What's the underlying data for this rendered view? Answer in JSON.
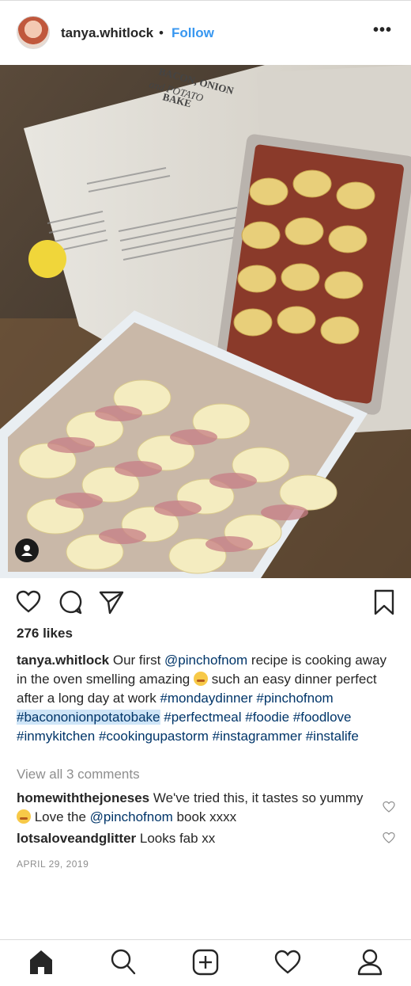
{
  "post": {
    "username": "tanya.whitlock",
    "separator": "•",
    "follow_label": "Follow",
    "more_label": "•••",
    "likes": "276 likes",
    "caption": {
      "username": "tanya.whitlock",
      "t1": " Our first ",
      "mention": "@pinchofnom",
      "t2": " recipe is cooking away in the oven smelling amazing ",
      "t3": "  such an easy dinner perfect after a long day at work ",
      "tag1": "#mondaydinner",
      "tag2": "#pinchofnom",
      "tag3": "#bacononionpotatobake",
      "tag4": "#perfectmeal",
      "tag5": "#foodie",
      "tag6": "#foodlove",
      "tag7": "#inmykitchen",
      "tag8": "#cookingupastorm",
      "tag9": "#instagrammer",
      "tag10": "#instalife"
    },
    "view_all": "View all 3 comments",
    "comments": [
      {
        "username": "homewiththejoneses",
        "t1": " We've tried this, it tastes so yummy ",
        "t2": "  Love the ",
        "mention": "@pinchofnom",
        "t3": " book xxxx"
      },
      {
        "username": "lotsaloveandglitter",
        "text": " Looks fab xx"
      }
    ],
    "date": "APRIL 29, 2019"
  },
  "photo_book": {
    "title_line1": "BACON, ONION",
    "title_line2": "and POTATO",
    "title_line3": "BAKE"
  },
  "colors": {
    "link": "#003569",
    "follow": "#3897f0",
    "muted": "#8e8e8e",
    "highlight": "#cfe5f7"
  }
}
